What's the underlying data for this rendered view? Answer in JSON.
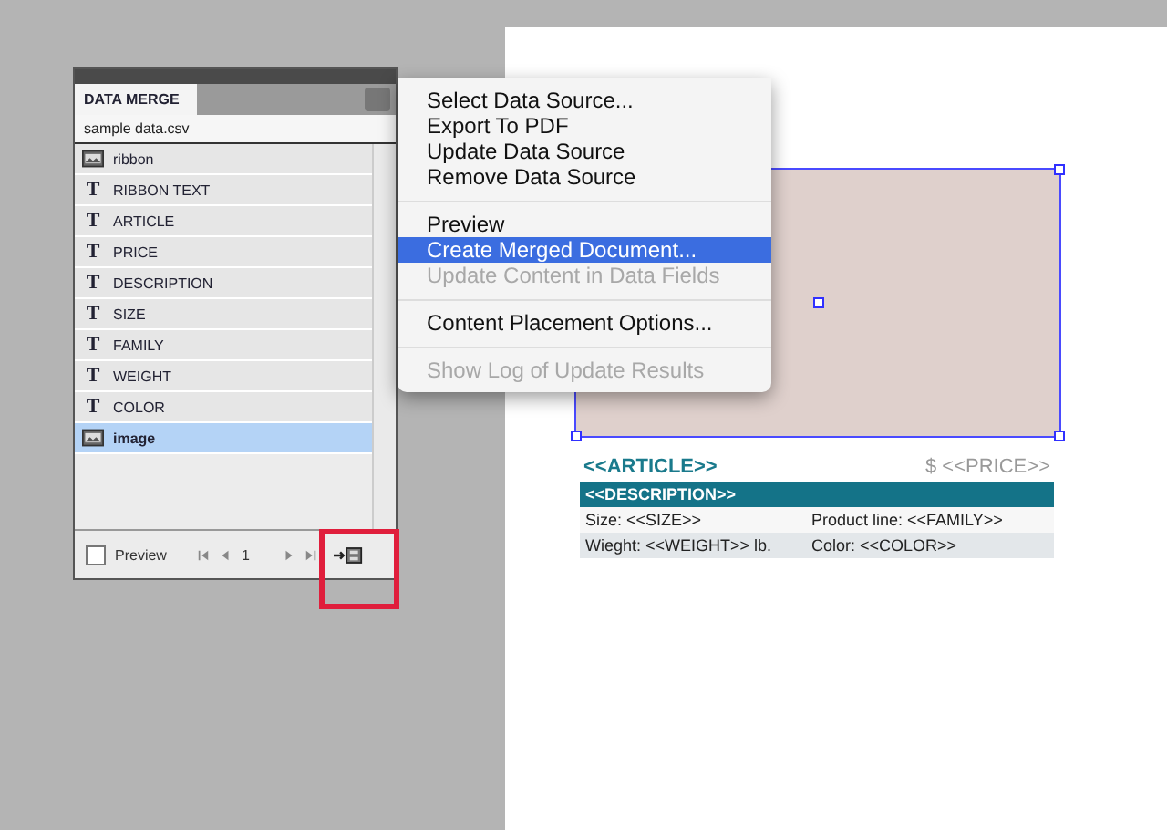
{
  "panel": {
    "tab": "DATA MERGE",
    "source": "sample data.csv",
    "fields": [
      {
        "kind": "image",
        "name": "ribbon",
        "selected": false
      },
      {
        "kind": "text",
        "icon": "T",
        "name": "RIBBON TEXT",
        "selected": false
      },
      {
        "kind": "text",
        "icon": "T",
        "name": "ARTICLE",
        "selected": false
      },
      {
        "kind": "text",
        "icon": "T",
        "name": "PRICE",
        "selected": false
      },
      {
        "kind": "text",
        "icon": "T",
        "name": "DESCRIPTION",
        "selected": false
      },
      {
        "kind": "text",
        "icon": "T",
        "name": "SIZE",
        "selected": false
      },
      {
        "kind": "text",
        "icon": "T",
        "name": "FAMILY",
        "selected": false
      },
      {
        "kind": "text",
        "icon": "T",
        "name": "WEIGHT",
        "selected": false
      },
      {
        "kind": "text",
        "icon": "T",
        "name": "COLOR",
        "selected": false
      },
      {
        "kind": "image",
        "name": "image",
        "selected": true
      }
    ],
    "preview": {
      "label": "Preview",
      "checked": false
    },
    "record": "1"
  },
  "menu": [
    {
      "kind": "item",
      "label": "Select Data Source...",
      "disabled": false,
      "selected": false
    },
    {
      "kind": "item",
      "label": "Export To PDF",
      "disabled": false,
      "selected": false
    },
    {
      "kind": "item",
      "label": "Update Data Source",
      "disabled": false,
      "selected": false
    },
    {
      "kind": "item",
      "label": "Remove Data Source",
      "disabled": false,
      "selected": false
    },
    {
      "kind": "separator"
    },
    {
      "kind": "item",
      "label": "Preview",
      "disabled": false,
      "selected": false
    },
    {
      "kind": "item",
      "label": "Create Merged Document...",
      "disabled": false,
      "selected": true
    },
    {
      "kind": "item",
      "label": "Update Content in Data Fields",
      "disabled": true,
      "selected": false
    },
    {
      "kind": "separator"
    },
    {
      "kind": "item",
      "label": "Content Placement Options...",
      "disabled": false,
      "selected": false
    },
    {
      "kind": "separator"
    },
    {
      "kind": "item",
      "label": "Show Log of Update Results",
      "disabled": true,
      "selected": false
    }
  ],
  "document": {
    "article": "<<ARTICLE>>",
    "price": "$ <<PRICE>>",
    "description": "<<DESCRIPTION>>",
    "rows": [
      [
        "Size: <<SIZE>>",
        "Product line: <<FAMILY>>"
      ],
      [
        "Wieght: <<WEIGHT>> lb.",
        "Color: <<COLOR>>"
      ]
    ]
  }
}
